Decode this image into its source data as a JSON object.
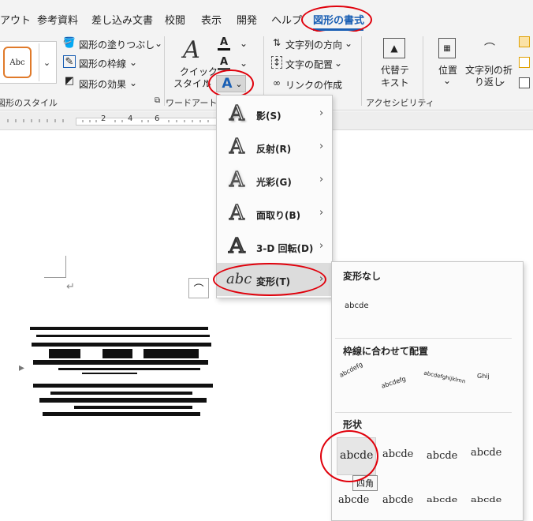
{
  "tabs": [
    "アウト",
    "参考資料",
    "差し込み文書",
    "校閲",
    "表示",
    "開発",
    "ヘルプ",
    "図形の書式"
  ],
  "ribbon": {
    "style_sample": "Abc",
    "fill": "図形の塗りつぶし",
    "outline": "図形の枠線",
    "effects": "図形の効果",
    "styles_group": "図形のスタイル",
    "quick1": "クイック",
    "quick2": "スタイル",
    "wordart_group": "ワードアートの",
    "text_direction": "文字列の方向",
    "text_align": "文字の配置",
    "create_link": "リンクの作成",
    "alt1": "代替テ",
    "alt2": "キスト",
    "a11y_group": "アクセシビリティ",
    "position": "位置",
    "wrap1": "文字列の折",
    "wrap2": "り返し"
  },
  "ruler": {
    "numbers": [
      "2",
      "4",
      "6"
    ]
  },
  "menu": {
    "items": [
      {
        "label": "影(S)",
        "icon": "shadow-effect-icon"
      },
      {
        "label": "反射(R)",
        "icon": "reflection-effect-icon"
      },
      {
        "label": "光彩(G)",
        "icon": "glow-effect-icon"
      },
      {
        "label": "面取り(B)",
        "icon": "bevel-effect-icon"
      },
      {
        "label": "3-D 回転(D)",
        "icon": "3d-rotation-effect-icon"
      },
      {
        "label": "変形(T)",
        "icon": "transform-effect-icon"
      }
    ]
  },
  "submenu": {
    "no_transform_header": "変形なし",
    "no_transform_sample": "abcde",
    "follow_path_header": "枠線に合わせて配置",
    "follow_path_samples": [
      "abcdefg",
      "abcdefghijklmn",
      "Ghij"
    ],
    "warp_header": "形状",
    "warp_samples": [
      "abcde",
      "abcde",
      "abcde",
      "abcde",
      "abcde",
      "abcde",
      "abcde",
      "abcde"
    ],
    "tooltip": "四角"
  },
  "colors": {
    "accent": "#1a5fb4",
    "highlight_circle": "#e0000b",
    "menu_selected": "#dcdcdc"
  }
}
